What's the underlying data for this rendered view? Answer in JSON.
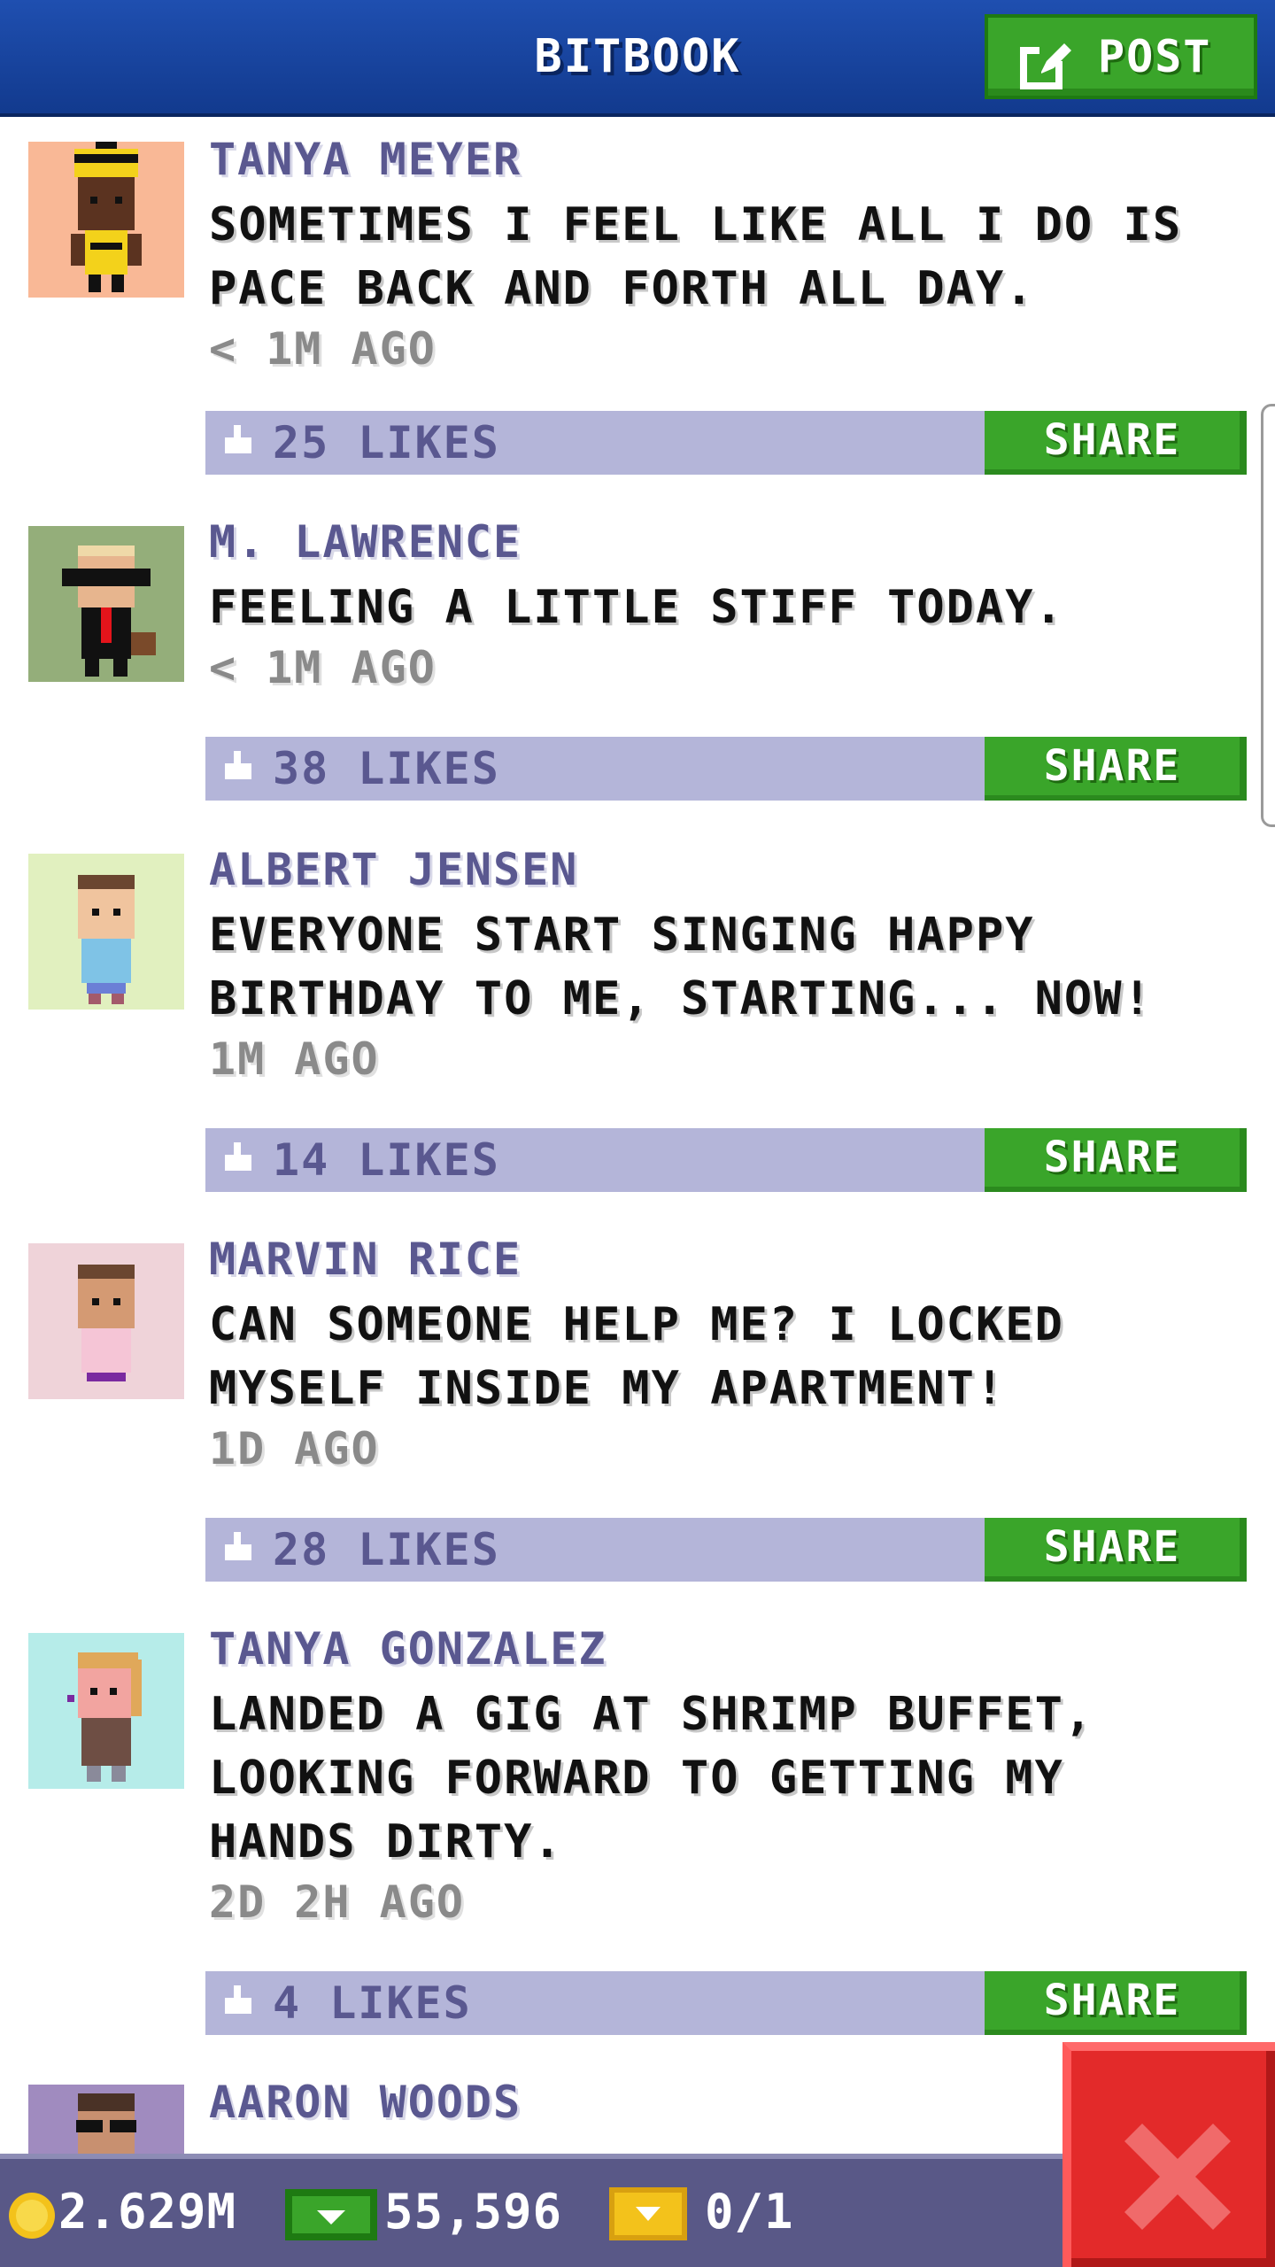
{
  "header": {
    "title": "BITBOOK",
    "post_label": "POST",
    "colors": {
      "bar": "#1a47a5",
      "post_button": "#3aa52a"
    }
  },
  "posts": [
    {
      "author": "TANYA MEYER",
      "message": "SOMETIMES I FEEL LIKE ALL I DO IS\nPACE BACK AND FORTH ALL DAY.",
      "time": "< 1M AGO",
      "likes": "25 LIKES",
      "share_label": "SHARE",
      "avatar_bg": "#f9b896"
    },
    {
      "author": "M. LAWRENCE",
      "message": "FEELING A LITTLE STIFF TODAY.",
      "time": "< 1M AGO",
      "likes": "38 LIKES",
      "share_label": "SHARE",
      "avatar_bg": "#94ae7a"
    },
    {
      "author": "ALBERT JENSEN",
      "message": "EVERYONE START SINGING HAPPY\nBIRTHDAY TO ME, STARTING... NOW!",
      "time": "1M AGO",
      "likes": "14 LIKES",
      "share_label": "SHARE",
      "avatar_bg": "#e1f0bf"
    },
    {
      "author": "MARVIN RICE",
      "message": "CAN SOMEONE HELP ME? I LOCKED\nMYSELF INSIDE MY APARTMENT!",
      "time": "1D AGO",
      "likes": "28 LIKES",
      "share_label": "SHARE",
      "avatar_bg": "#efd3d9"
    },
    {
      "author": "TANYA GONZALEZ",
      "message": "LANDED A GIG AT SHRIMP BUFFET,\nLOOKING FORWARD TO GETTING MY\nHANDS DIRTY.",
      "time": "2D 2H AGO",
      "likes": "4 LIKES",
      "share_label": "SHARE",
      "avatar_bg": "#b6ece9"
    },
    {
      "author": "AARON WOODS",
      "message": "",
      "time": "",
      "likes": "",
      "share_label": "",
      "avatar_bg": "#a08bbf"
    }
  ],
  "status_bar": {
    "coins": "2.629M",
    "bux": "55,596",
    "tickets": "0/1",
    "icons": [
      "coin-icon",
      "bux-icon",
      "ticket-icon"
    ]
  },
  "close_button": {
    "icon": "close-icon",
    "color": "#e32a2a"
  }
}
